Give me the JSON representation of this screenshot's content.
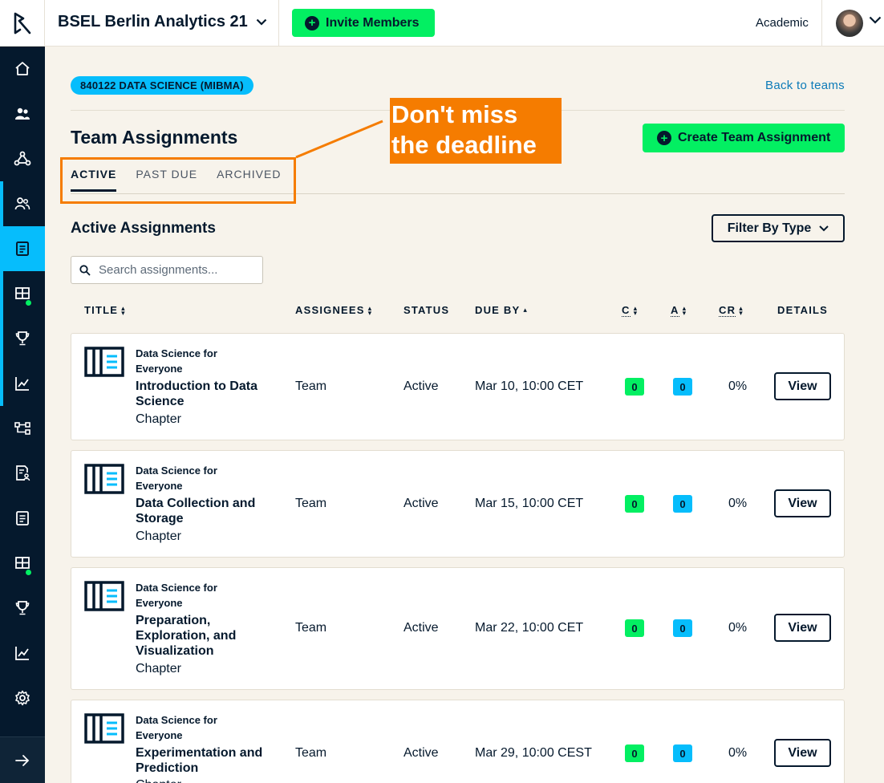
{
  "topbar": {
    "org_name": "BSEL Berlin Analytics 21",
    "invite_label": "Invite Members",
    "plan_label": "Academic"
  },
  "main": {
    "course_badge": "840122 DATA SCIENCE (MIBMA)",
    "back_link": "Back to teams",
    "page_title": "Team Assignments",
    "create_label": "Create Team Assignment",
    "tabs": [
      {
        "label": "ACTIVE",
        "active": true
      },
      {
        "label": "PAST DUE",
        "active": false
      },
      {
        "label": "ARCHIVED",
        "active": false
      }
    ],
    "annotation": "Don't miss the deadline",
    "section_title": "Active Assignments",
    "filter_label": "Filter By Type",
    "search_placeholder": "Search assignments..."
  },
  "table": {
    "columns": {
      "title": "TITLE",
      "assignees": "ASSIGNEES",
      "status": "STATUS",
      "due_by": "DUE BY",
      "c": "C",
      "a": "A",
      "cr": "CR",
      "details": "DETAILS"
    },
    "rows": [
      {
        "course": "Data Science for Everyone",
        "title": "Introduction to Data Science",
        "type": "Chapter",
        "assignees": "Team",
        "status": "Active",
        "due": "Mar 10, 10:00 CET",
        "c": "0",
        "a": "0",
        "cr": "0%",
        "action": "View"
      },
      {
        "course": "Data Science for Everyone",
        "title": "Data Collection and Storage",
        "type": "Chapter",
        "assignees": "Team",
        "status": "Active",
        "due": "Mar 15, 10:00 CET",
        "c": "0",
        "a": "0",
        "cr": "0%",
        "action": "View"
      },
      {
        "course": "Data Science for Everyone",
        "title": "Preparation, Exploration, and Visualization",
        "type": "Chapter",
        "assignees": "Team",
        "status": "Active",
        "due": "Mar 22, 10:00 CET",
        "c": "0",
        "a": "0",
        "cr": "0%",
        "action": "View"
      },
      {
        "course": "Data Science for Everyone",
        "title": "Experimentation and Prediction",
        "type": "Chapter",
        "assignees": "Team",
        "status": "Active",
        "due": "Mar 29, 10:00 CEST",
        "c": "0",
        "a": "0",
        "cr": "0%",
        "action": "View"
      }
    ]
  },
  "sidebar": {
    "icons": [
      "home-icon",
      "group-icon",
      "network-icon",
      "team-members-icon",
      "assignments-icon",
      "grid-icon",
      "trophy-icon",
      "chart-icon",
      "workflow-icon",
      "doc-user-icon",
      "document-icon",
      "grid-icon",
      "trophy-icon",
      "chart-icon",
      "settings-icon",
      "arrow-right-icon"
    ]
  },
  "colors": {
    "brand_green": "#03ef62",
    "brand_blue": "#06bdfc",
    "navy": "#05192d",
    "annotation_orange": "#f57c00"
  }
}
